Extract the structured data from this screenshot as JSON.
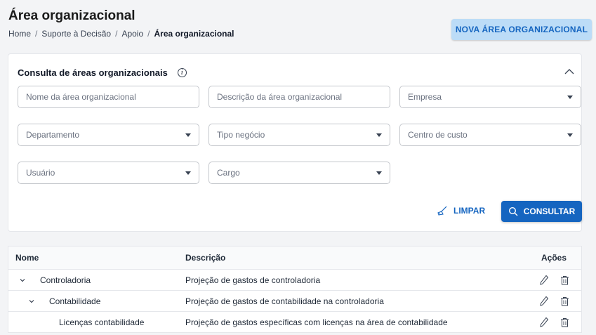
{
  "header": {
    "title": "Área organizacional",
    "breadcrumb": [
      "Home",
      "Suporte à Decisão",
      "Apoio",
      "Área organizacional"
    ],
    "breadcrumb_separator": "/",
    "new_button": "NOVA ÁREA ORGANIZACIONAL"
  },
  "search": {
    "title": "Consulta de áreas organizacionais",
    "fields": {
      "nome": "Nome da área organizacional",
      "descricao": "Descrição da área organizacional",
      "empresa": "Empresa",
      "departamento": "Departamento",
      "tipo_negocio": "Tipo negócio",
      "centro_custo": "Centro de custo",
      "usuario": "Usuário",
      "cargo": "Cargo"
    },
    "clear_button": "LIMPAR",
    "search_button": "CONSULTAR"
  },
  "table": {
    "columns": [
      "Nome",
      "Descrição",
      "Ações"
    ],
    "rows": [
      {
        "name": "Controladoria",
        "description": "Projeção de gastos de controladoria"
      },
      {
        "name": "Contabilidade",
        "description": "Projeção de gastos de contabilidade na controladoria"
      },
      {
        "name": "Licenças contabilidade",
        "description": "Projeção de gastos específicas com licenças na área de contabilidade"
      }
    ]
  },
  "colors": {
    "primary": "#1565c0",
    "primary_light": "#bcdcf7"
  }
}
